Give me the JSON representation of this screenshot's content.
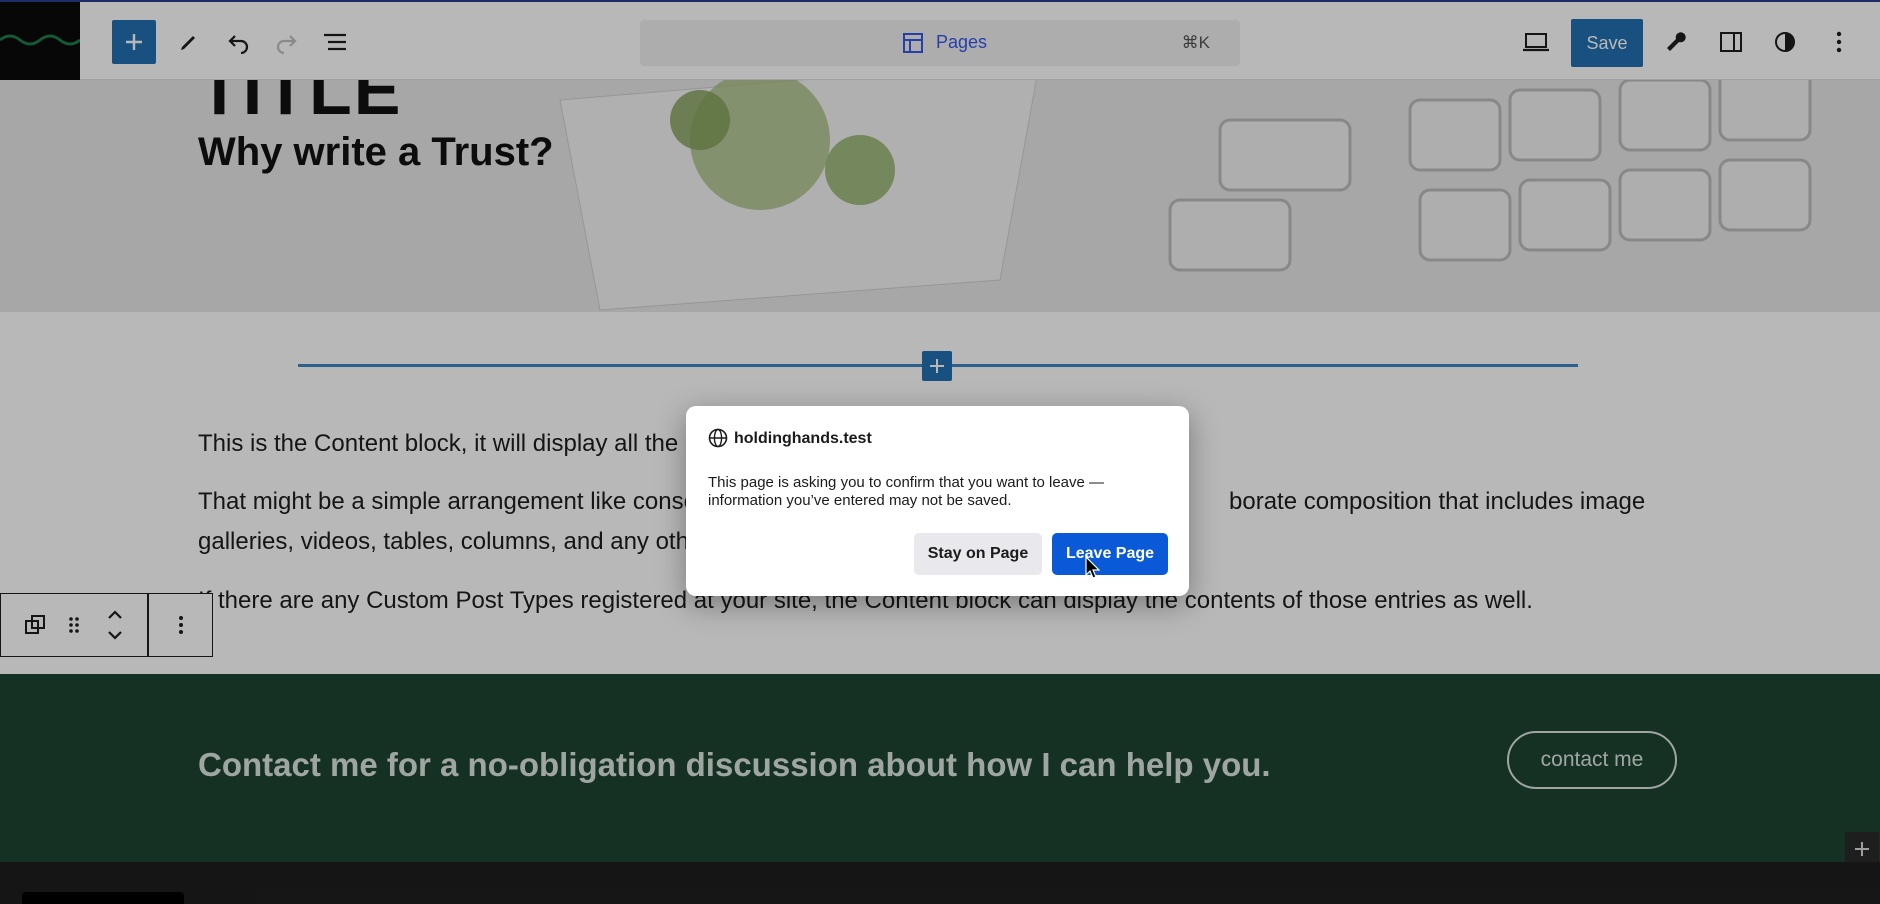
{
  "toolbar": {
    "doc_title": "Pages",
    "shortcut": "⌘K",
    "save_label": "Save",
    "icons": [
      "plus-icon",
      "pencil-icon",
      "undo-icon",
      "redo-icon",
      "list-view-icon",
      "desktop-icon",
      "wrench-icon",
      "sidebar-icon",
      "contrast-icon",
      "more-vertical-icon"
    ],
    "accent": "#2271b1"
  },
  "hero": {
    "title": "TITLE",
    "subtitle": "Why write a Trust?"
  },
  "content": {
    "p1": "This is the Content block, it will display all the b",
    "p2a": "That might be a simple arrangement like conse",
    "p2b": "borate composition that includes image",
    "p2c": "galleries, videos, tables, columns, and any othe",
    "p3": "If there are any Custom Post Types registered at your site, the Content block can display the contents of those entries as well."
  },
  "footer": {
    "text": "Contact me for a no-obligation discussion about how I can help you.",
    "button": "contact me",
    "bg": "#1d4432"
  },
  "dialog": {
    "host": "holdinghands.test",
    "message": "This page is asking you to confirm that you want to leave — information you’ve entered may not be saved.",
    "stay_label": "Stay on Page",
    "leave_label": "Leave Page",
    "leave_color": "#0a5ad8"
  }
}
